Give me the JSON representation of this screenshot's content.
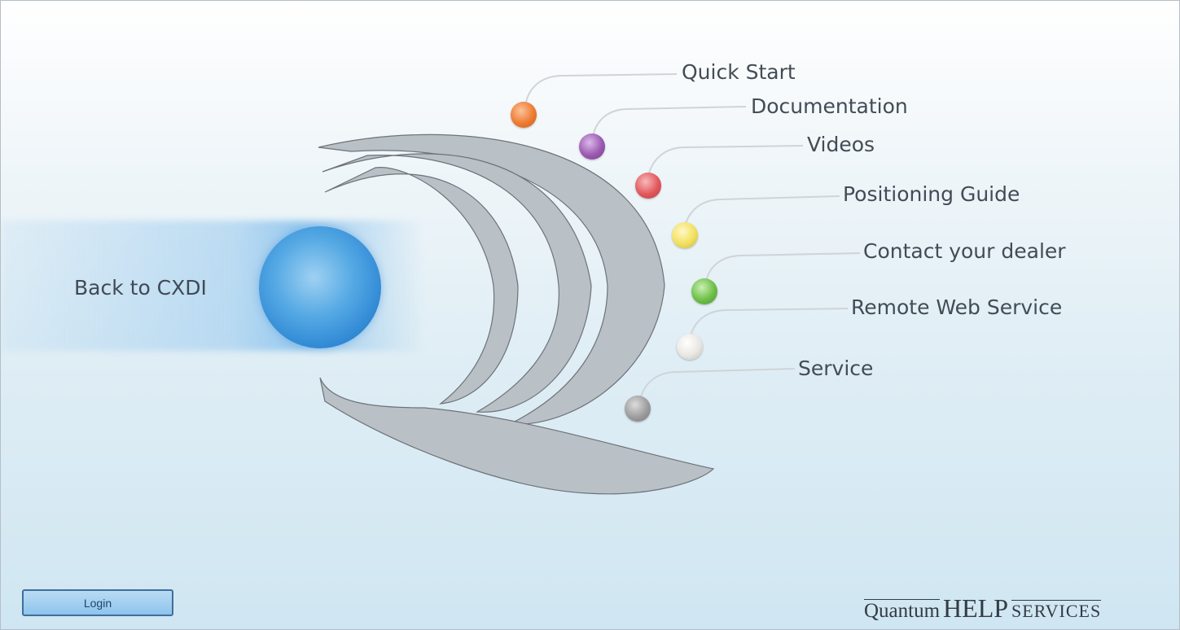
{
  "back_link": {
    "label": "Back to CXDI"
  },
  "menu": [
    {
      "label": "Quick Start",
      "color": "#ee7b32"
    },
    {
      "label": "Documentation",
      "color": "#9b5ab1"
    },
    {
      "label": "Videos",
      "color": "#e2585c"
    },
    {
      "label": "Positioning Guide",
      "color": "#f2e05e"
    },
    {
      "label": "Contact your dealer",
      "color": "#6dbf48"
    },
    {
      "label": "Remote Web Service",
      "color": "#e9e7e2"
    },
    {
      "label": "Service",
      "color": "#9d9d9d"
    }
  ],
  "login": {
    "label": "Login"
  },
  "brand": {
    "word1": "Quantum",
    "word2": "HELP",
    "word3": "SERVICES"
  }
}
